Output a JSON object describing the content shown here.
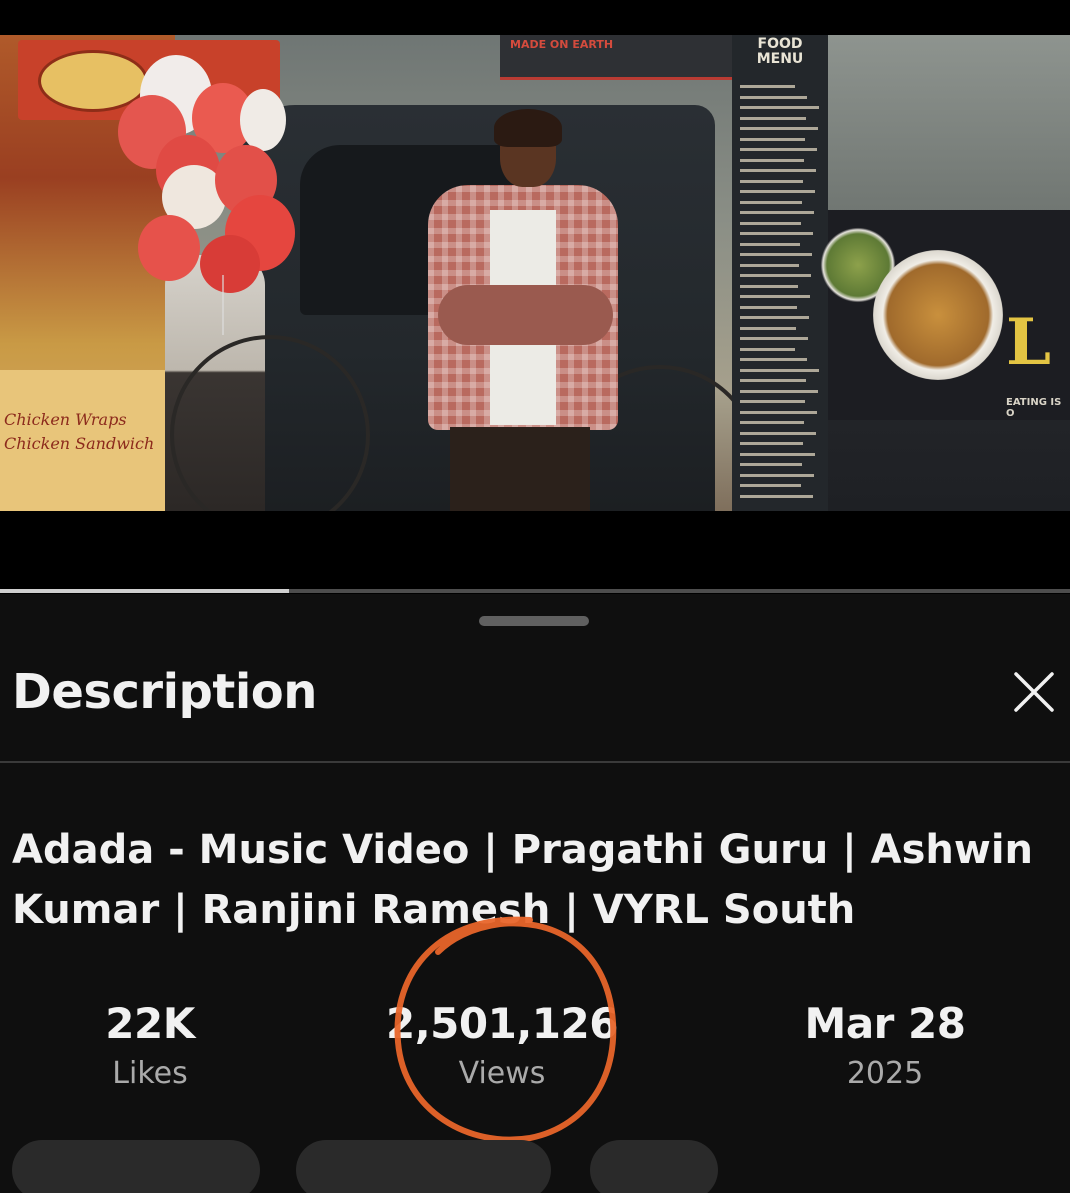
{
  "player": {
    "progress_fraction": 0.27,
    "scene_texts": {
      "top_sign": "MADE ON EARTH",
      "menu_title": "FOOD MENU",
      "left_sign_line1": "Chicken Wraps",
      "left_sign_line2": "Chicken Sandwich",
      "right_sign_letter": "L",
      "right_sign_tagline": "EATING IS O"
    }
  },
  "description_panel": {
    "title": "Description",
    "close_icon": "close-x-icon",
    "video_title": "Adada - Music Video | Pragathi Guru | Ashwin Kumar | Ranjini Ramesh | VYRL South",
    "stats": {
      "likes_value": "22K",
      "likes_label": "Likes",
      "views_value": "2,501,126",
      "views_label": "Views",
      "date_value": "Mar 28",
      "date_year": "2025"
    },
    "annotation_color": "#e8652a"
  }
}
